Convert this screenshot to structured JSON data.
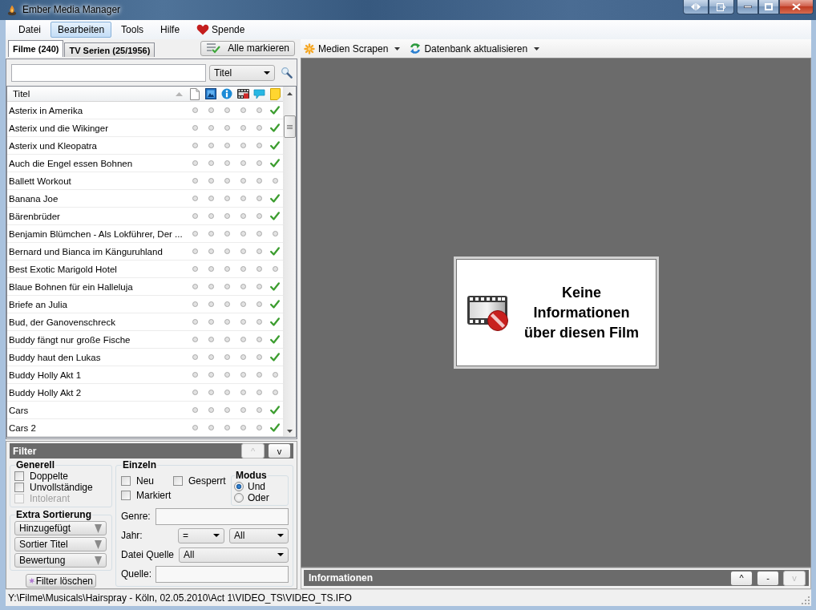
{
  "window": {
    "title": "Ember Media Manager"
  },
  "menu": [
    {
      "label": "Datei",
      "kind": "text",
      "selected": false
    },
    {
      "label": "Bearbeiten",
      "kind": "text",
      "selected": true
    },
    {
      "label": "Tools",
      "kind": "text",
      "selected": false
    },
    {
      "label": "Hilfe",
      "kind": "text",
      "selected": false
    },
    {
      "label": "Spende",
      "kind": "heart",
      "selected": false
    }
  ],
  "tabs": [
    {
      "label": "Filme (240)",
      "selected": true
    },
    {
      "label": "TV Serien (25/1956)",
      "selected": false
    }
  ],
  "mark_all_button": {
    "label": "Alle markieren"
  },
  "toolbar": [
    {
      "label": "Medien Scrapen",
      "kind": "scrape"
    },
    {
      "label": "Datenbank aktualisieren",
      "kind": "refresh"
    }
  ],
  "search": {
    "column": "Titel"
  },
  "list": {
    "title_column": {
      "label": "Titel",
      "sorted_ascending": true
    },
    "rows": [
      {
        "title": "Asterix in Amerika",
        "selected": false,
        "flags": [
          false,
          false,
          false,
          false,
          false,
          true
        ]
      },
      {
        "title": "Asterix und die Wikinger",
        "selected": false,
        "flags": [
          false,
          false,
          false,
          false,
          false,
          true
        ]
      },
      {
        "title": "Asterix und Kleopatra",
        "selected": false,
        "flags": [
          false,
          false,
          false,
          false,
          false,
          true
        ]
      },
      {
        "title": "Auch die Engel essen Bohnen",
        "selected": false,
        "flags": [
          false,
          false,
          false,
          false,
          false,
          true
        ]
      },
      {
        "title": "Ballett Workout",
        "selected": false,
        "flags": [
          false,
          false,
          false,
          false,
          false,
          false
        ]
      },
      {
        "title": "Banana Joe",
        "selected": false,
        "flags": [
          false,
          false,
          false,
          false,
          false,
          true
        ]
      },
      {
        "title": "Bärenbrüder",
        "selected": false,
        "flags": [
          false,
          false,
          false,
          false,
          false,
          true
        ]
      },
      {
        "title": "Benjamin Blümchen - Als Lokführer, Der ...",
        "selected": false,
        "flags": [
          false,
          false,
          false,
          false,
          false,
          false
        ]
      },
      {
        "title": "Bernard und Bianca im Känguruhland",
        "selected": false,
        "flags": [
          false,
          false,
          false,
          false,
          false,
          true
        ]
      },
      {
        "title": "Best Exotic Marigold Hotel",
        "selected": false,
        "flags": [
          false,
          false,
          false,
          false,
          false,
          false
        ]
      },
      {
        "title": "Blaue Bohnen für ein Halleluja",
        "selected": false,
        "flags": [
          false,
          false,
          false,
          false,
          false,
          true
        ]
      },
      {
        "title": "Briefe an Julia",
        "selected": false,
        "flags": [
          false,
          false,
          false,
          false,
          false,
          true
        ]
      },
      {
        "title": "Bud, der Ganovenschreck",
        "selected": false,
        "flags": [
          false,
          false,
          false,
          false,
          false,
          true
        ]
      },
      {
        "title": "Buddy fängt nur große Fische",
        "selected": false,
        "flags": [
          false,
          false,
          false,
          false,
          false,
          true
        ]
      },
      {
        "title": "Buddy haut den Lukas",
        "selected": false,
        "flags": [
          false,
          false,
          false,
          false,
          false,
          true
        ]
      },
      {
        "title": "Buddy Holly Akt 1",
        "selected": false,
        "flags": [
          false,
          false,
          false,
          false,
          false,
          false
        ]
      },
      {
        "title": "Buddy Holly Akt 2",
        "selected": false,
        "flags": [
          false,
          false,
          false,
          false,
          false,
          false
        ]
      },
      {
        "title": "Cars",
        "selected": false,
        "flags": [
          false,
          false,
          false,
          false,
          false,
          true
        ]
      },
      {
        "title": "Cars 2",
        "selected": false,
        "flags": [
          false,
          false,
          false,
          false,
          false,
          true
        ]
      }
    ]
  },
  "filter": {
    "title": "Filter",
    "buttons": [
      {
        "label": "^",
        "disabled": true
      },
      {
        "label": "v",
        "disabled": false
      }
    ],
    "general": {
      "title": "Generell",
      "options": [
        {
          "label": "Doppelte",
          "checked": false,
          "disabled": false
        },
        {
          "label": "Unvollständige",
          "checked": false,
          "disabled": false
        },
        {
          "label": "Intolerant",
          "checked": false,
          "disabled": true
        }
      ]
    },
    "extra_sort": {
      "title": "Extra Sortierung",
      "dropdowns": [
        "Hinzugefügt",
        "Sortier Titel",
        "Bewertung"
      ]
    },
    "clear_button": {
      "label": "Filter löschen"
    },
    "single": {
      "title": "Einzeln",
      "options": [
        {
          "label": "Neu",
          "checked": false
        },
        {
          "label": "Gesperrt",
          "checked": false
        },
        {
          "label": "Markiert",
          "checked": false
        }
      ],
      "mode": {
        "title": "Modus",
        "options": [
          {
            "label": "Und",
            "selected": true
          },
          {
            "label": "Oder",
            "selected": false
          }
        ]
      },
      "genre": {
        "label": "Genre:"
      },
      "year": {
        "label": "Jahr:",
        "operator": "=",
        "value": "All"
      },
      "file_source": {
        "label": "Datei Quelle",
        "value": "All"
      },
      "source": {
        "label": "Quelle:"
      }
    }
  },
  "info_box": {
    "text": "Keine Informationen über diesen Film"
  },
  "info_bar": {
    "title": "Informationen",
    "buttons": [
      {
        "label": "^",
        "disabled": false
      },
      {
        "label": "-",
        "disabled": false
      },
      {
        "label": "v",
        "disabled": true
      }
    ]
  },
  "status_bar": {
    "path": "Y:\\Filme\\Musicals\\Hairspray - Köln, 02.05.2010\\Act 1\\VIDEO_TS\\VIDEO_TS.IFO"
  }
}
